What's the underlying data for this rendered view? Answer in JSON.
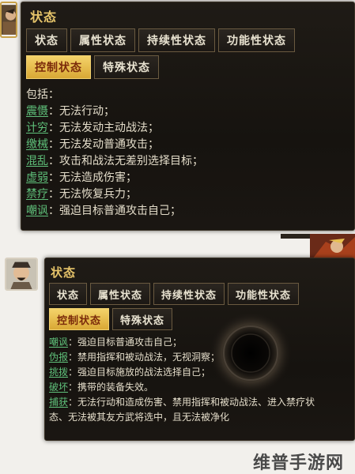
{
  "top": {
    "title": "状态",
    "tabs_row1": [
      "状态",
      "属性状态",
      "持续性状态",
      "功能性状态"
    ],
    "tabs_row2": [
      "控制状态",
      "特殊状态"
    ],
    "active_tab": "控制状态",
    "intro": "包括：",
    "entries": [
      {
        "term": "震慑",
        "desc": "：无法行动；"
      },
      {
        "term": "计穷",
        "desc": "：无法发动主动战法；"
      },
      {
        "term": "缴械",
        "desc": "：无法发动普通攻击；"
      },
      {
        "term": "混乱",
        "desc": "：攻击和战法无差别选择目标；"
      },
      {
        "term": "虚弱",
        "desc": "：无法造成伤害；"
      },
      {
        "term": "禁疗",
        "desc": "：无法恢复兵力；"
      },
      {
        "term": "嘲讽",
        "desc": "：强迫目标普通攻击自己；"
      }
    ]
  },
  "bottom": {
    "title": "状态",
    "tabs_row1": [
      "状态",
      "属性状态",
      "持续性状态",
      "功能性状态"
    ],
    "tabs_row2": [
      "控制状态",
      "特殊状态"
    ],
    "active_tab": "控制状态",
    "entries": [
      {
        "term": "嘲讽",
        "desc": "：强迫目标普通攻击自己；"
      },
      {
        "term": "伪报",
        "desc": "：禁用指挥和被动战法，无视洞察；"
      },
      {
        "term": "挑拨",
        "desc": "：强迫目标施放的战法选择自己；"
      },
      {
        "term": "破坏",
        "desc": "：携带的装备失效。"
      },
      {
        "term": "捕获",
        "desc": "：无法行动和造成伤害、禁用指挥和被动战法、进入禁疗状态、无法被其友方武将选中，且无法被净化"
      }
    ]
  },
  "watermark": "维普手游网",
  "colors": {
    "gold": "#e6c46a",
    "term_green": "#5fc07a",
    "active_tab_bg": "#d9a835"
  }
}
